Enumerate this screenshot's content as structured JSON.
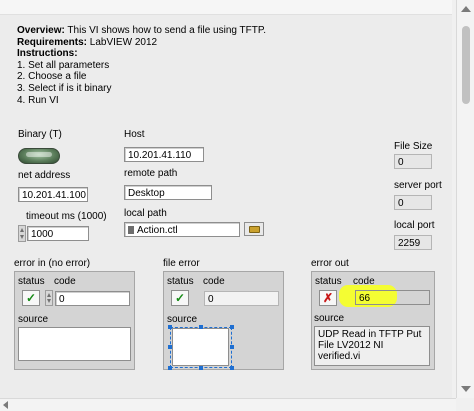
{
  "overview": {
    "overview_label": "Overview:",
    "overview_text": "This VI shows how to send a file using TFTP.",
    "requirements_label": "Requirements:",
    "requirements_text": "LabVIEW 2012",
    "instructions_label": "Instructions:",
    "steps": [
      "1. Set all parameters",
      "2. Choose a file",
      "3. Select if is it binary",
      "4. Run VI"
    ]
  },
  "binary": {
    "label": "Binary (T)",
    "value": true
  },
  "host": {
    "label": "Host",
    "value": "10.201.41.110"
  },
  "remote_path": {
    "label": "remote path",
    "value": "Desktop"
  },
  "local_path": {
    "label": "local path",
    "value": "Action.ctl"
  },
  "net_address": {
    "label": "net address",
    "value": "10.201.41.100"
  },
  "timeout": {
    "label": "timeout ms (1000)",
    "value": "1000"
  },
  "file_size": {
    "label": "File Size",
    "value": "0"
  },
  "server_port": {
    "label": "server port",
    "value": "0"
  },
  "local_port": {
    "label": "local port",
    "value": "2259"
  },
  "error_in": {
    "title": "error in (no error)",
    "status_label": "status",
    "code_label": "code",
    "source_label": "source",
    "code": "0",
    "status_glyph": "✓",
    "source": ""
  },
  "file_error": {
    "title": "file error",
    "status_label": "status",
    "code_label": "code",
    "source_label": "source",
    "code": "0",
    "status_glyph": "✓",
    "source": ""
  },
  "error_out": {
    "title": "error out",
    "status_label": "status",
    "code_label": "code",
    "source_label": "source",
    "code": "66",
    "status_glyph": "✗",
    "source_lines": [
      "UDP Read in TFTP Put",
      "File LV2012 NI",
      "verified.vi"
    ]
  },
  "colors": {
    "highlight": "#f6ff2a",
    "ok": "#168a16",
    "error": "#c81616",
    "selection": "#1f6fd1"
  }
}
